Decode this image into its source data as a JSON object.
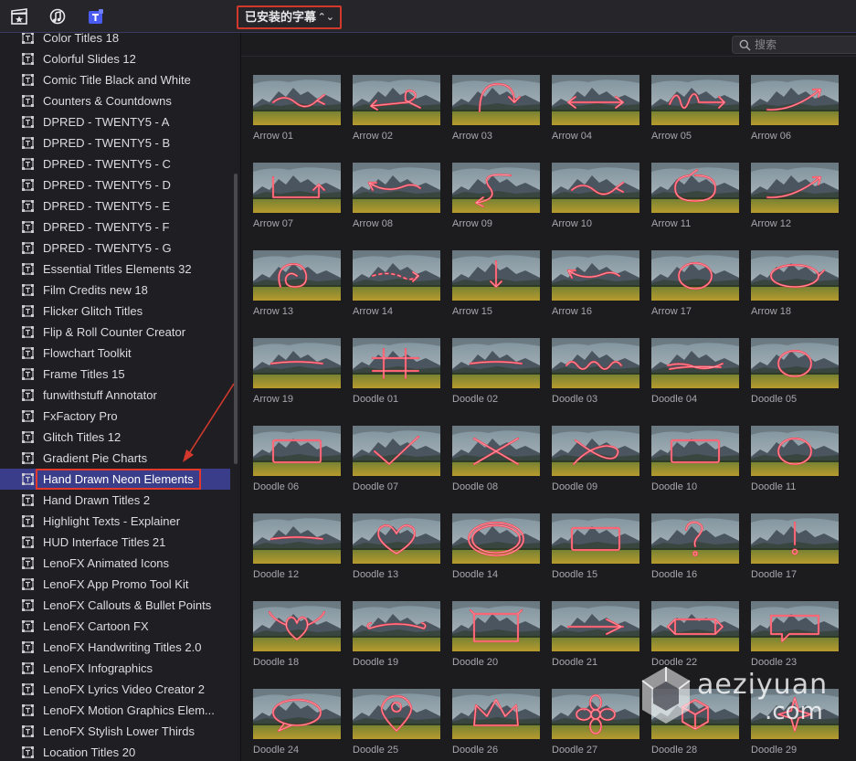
{
  "toolbar": {
    "icons": [
      "clapper-star-icon",
      "music-note-icon",
      "titles-T-icon"
    ],
    "dropdown_label": "已安装的字幕",
    "dropdown_chevron": "⌃⌄"
  },
  "search": {
    "placeholder": "搜索"
  },
  "sidebar": {
    "items": [
      {
        "label": "Color Titles 18"
      },
      {
        "label": "Colorful Slides 12"
      },
      {
        "label": "Comic Title Black and White"
      },
      {
        "label": "Counters & Countdowns"
      },
      {
        "label": "DPRED - TWENTY5 - A"
      },
      {
        "label": "DPRED - TWENTY5 - B"
      },
      {
        "label": "DPRED - TWENTY5 - C"
      },
      {
        "label": "DPRED - TWENTY5 - D"
      },
      {
        "label": "DPRED - TWENTY5 - E"
      },
      {
        "label": "DPRED - TWENTY5 - F"
      },
      {
        "label": "DPRED - TWENTY5 - G"
      },
      {
        "label": "Essential Titles Elements 32"
      },
      {
        "label": "Film Credits new 18"
      },
      {
        "label": "Flicker Glitch Titles"
      },
      {
        "label": "Flip & Roll Counter Creator"
      },
      {
        "label": "Flowchart Toolkit"
      },
      {
        "label": "Frame Titles 15"
      },
      {
        "label": "funwithstuff Annotator"
      },
      {
        "label": "FxFactory Pro"
      },
      {
        "label": "Glitch Titles 12"
      },
      {
        "label": "Gradient Pie Charts"
      },
      {
        "label": "Hand Drawn Neon Elements",
        "selected": true
      },
      {
        "label": "Hand Drawn Titles 2"
      },
      {
        "label": "Highlight Texts - Explainer"
      },
      {
        "label": "HUD Interface Titles 21"
      },
      {
        "label": "LenoFX Animated Icons"
      },
      {
        "label": "LenoFX App Promo Tool Kit"
      },
      {
        "label": "LenoFX Callouts & Bullet Points"
      },
      {
        "label": "LenoFX Cartoon FX"
      },
      {
        "label": "LenoFX Handwriting Titles 2.0"
      },
      {
        "label": "LenoFX Infographics"
      },
      {
        "label": "LenoFX Lyrics Video Creator 2"
      },
      {
        "label": "LenoFX Motion Graphics Elem..."
      },
      {
        "label": "LenoFX Stylish Lower Thirds"
      },
      {
        "label": "Location Titles 20"
      }
    ]
  },
  "browser": {
    "accent_color": "#ff3b4e",
    "tiles": [
      {
        "label": "Arrow 01",
        "doodle": "wave-arrow"
      },
      {
        "label": "Arrow 02",
        "doodle": "loop-arrow"
      },
      {
        "label": "Arrow 03",
        "doodle": "arc-arrow"
      },
      {
        "label": "Arrow 04",
        "doodle": "double-arrow"
      },
      {
        "label": "Arrow 05",
        "doodle": "loops-arrow"
      },
      {
        "label": "Arrow 06",
        "doodle": "swoosh-arrow"
      },
      {
        "label": "Arrow 07",
        "doodle": "bracket-arrow"
      },
      {
        "label": "Arrow 08",
        "doodle": "curve-arrow"
      },
      {
        "label": "Arrow 09",
        "doodle": "s-arrow"
      },
      {
        "label": "Arrow 10",
        "doodle": "wave-arrow"
      },
      {
        "label": "Arrow 11",
        "doodle": "circle-arrow"
      },
      {
        "label": "Arrow 12",
        "doodle": "swoosh-arrow"
      },
      {
        "label": "Arrow 13",
        "doodle": "spiral-arrow"
      },
      {
        "label": "Arrow 14",
        "doodle": "dotted-arrow"
      },
      {
        "label": "Arrow 15",
        "doodle": "down-arrow"
      },
      {
        "label": "Arrow 16",
        "doodle": "curve-arrow"
      },
      {
        "label": "Arrow 17",
        "doodle": "circle"
      },
      {
        "label": "Arrow 18",
        "doodle": "ellipse-arrow"
      },
      {
        "label": "Arrow 19",
        "doodle": "line"
      },
      {
        "label": "Doodle 01",
        "doodle": "hash"
      },
      {
        "label": "Doodle 02",
        "doodle": "line"
      },
      {
        "label": "Doodle 03",
        "doodle": "squiggle"
      },
      {
        "label": "Doodle 04",
        "doodle": "scribble-line"
      },
      {
        "label": "Doodle 05",
        "doodle": "circle"
      },
      {
        "label": "Doodle 06",
        "doodle": "rect"
      },
      {
        "label": "Doodle 07",
        "doodle": "check"
      },
      {
        "label": "Doodle 08",
        "doodle": "cross"
      },
      {
        "label": "Doodle 09",
        "doodle": "x-loop"
      },
      {
        "label": "Doodle 10",
        "doodle": "rect"
      },
      {
        "label": "Doodle 11",
        "doodle": "circle"
      },
      {
        "label": "Doodle 12",
        "doodle": "line"
      },
      {
        "label": "Doodle 13",
        "doodle": "heart"
      },
      {
        "label": "Doodle 14",
        "doodle": "big-ellipse"
      },
      {
        "label": "Doodle 15",
        "doodle": "rect"
      },
      {
        "label": "Doodle 16",
        "doodle": "question"
      },
      {
        "label": "Doodle 17",
        "doodle": "exclaim"
      },
      {
        "label": "Doodle 18",
        "doodle": "heart-wings"
      },
      {
        "label": "Doodle 19",
        "doodle": "scroll"
      },
      {
        "label": "Doodle 20",
        "doodle": "rect-frame"
      },
      {
        "label": "Doodle 21",
        "doodle": "banner-line"
      },
      {
        "label": "Doodle 22",
        "doodle": "ribbon"
      },
      {
        "label": "Doodle 23",
        "doodle": "speech"
      },
      {
        "label": "Doodle 24",
        "doodle": "speech-round"
      },
      {
        "label": "Doodle 25",
        "doodle": "pin"
      },
      {
        "label": "Doodle 26",
        "doodle": "crown"
      },
      {
        "label": "Doodle 27",
        "doodle": "flower"
      },
      {
        "label": "Doodle 28",
        "doodle": "cube"
      },
      {
        "label": "Doodle 29",
        "doodle": "sparkle"
      }
    ]
  },
  "watermark": {
    "text": "aeziyuan",
    "suffix": ".com"
  }
}
